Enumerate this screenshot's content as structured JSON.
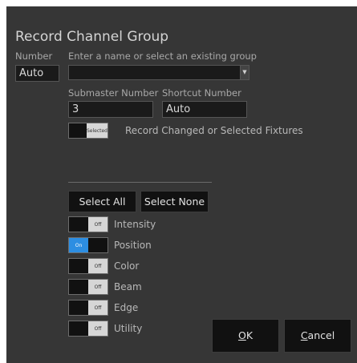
{
  "dialog": {
    "title": "Record Channel Group"
  },
  "number": {
    "label": "Number",
    "value": "Auto"
  },
  "group": {
    "label": "Enter a name or select an existing group",
    "value": ""
  },
  "submaster": {
    "label": "Submaster Number",
    "value": "3"
  },
  "shortcut": {
    "label": "Shortcut Number",
    "value": "Auto"
  },
  "record_mode": {
    "toggle_text": "Selected",
    "label": "Record Changed or Selected Fixtures",
    "state": "selected"
  },
  "buttons": {
    "select_all": "Select All",
    "select_none": "Select None",
    "ok_accel": "O",
    "ok_rest": "K",
    "cancel_accel": "C",
    "cancel_rest": "ancel"
  },
  "parameters": [
    {
      "label": "Intensity",
      "state": "Off"
    },
    {
      "label": "Position",
      "state": "On"
    },
    {
      "label": "Color",
      "state": "Off"
    },
    {
      "label": "Beam",
      "state": "Off"
    },
    {
      "label": "Edge",
      "state": "Off"
    },
    {
      "label": "Utility",
      "state": "Off"
    }
  ],
  "colors": {
    "background": "#363636",
    "field": "#1a1a1a",
    "toggle_on": "#2d8ee2",
    "toggle_off": "#d6d6d6"
  }
}
